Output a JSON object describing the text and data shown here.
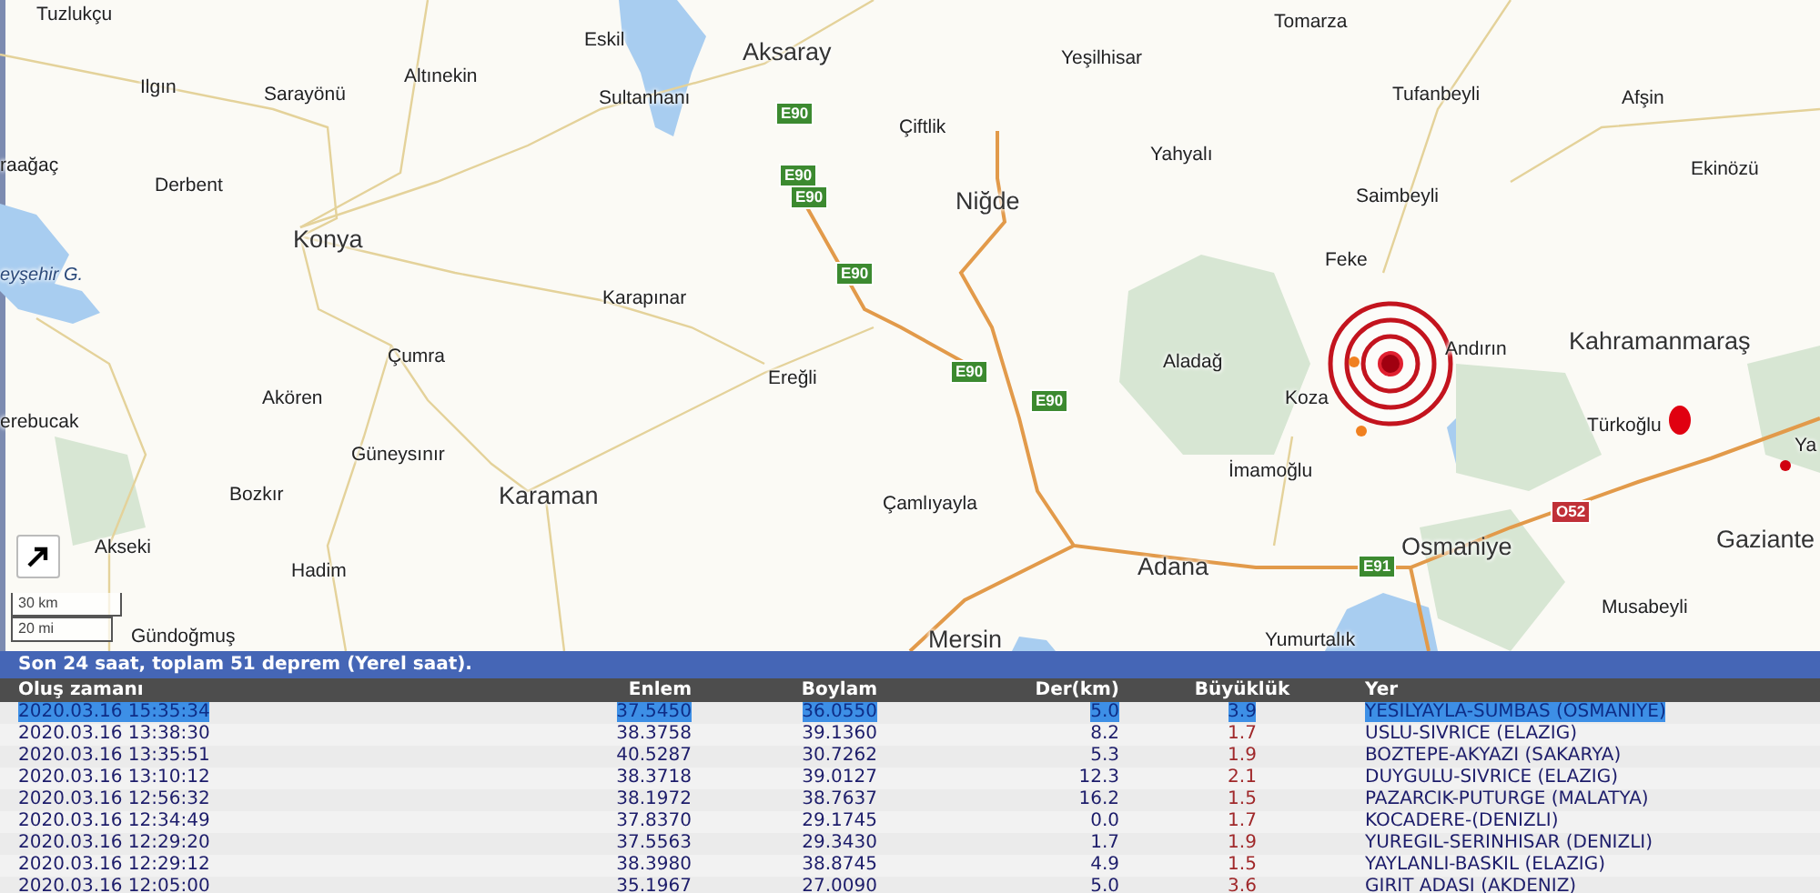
{
  "map": {
    "places": [
      {
        "name": "Tuzlukçu",
        "kind": "town"
      },
      {
        "name": "Ilgın",
        "kind": "town"
      },
      {
        "name": "Sarayönü",
        "kind": "town"
      },
      {
        "name": "Altınekin",
        "kind": "town"
      },
      {
        "name": "Eskil",
        "kind": "town"
      },
      {
        "name": "Sultanhanı",
        "kind": "town"
      },
      {
        "name": "Aksaray",
        "kind": "city"
      },
      {
        "name": "raağaç",
        "kind": "town"
      },
      {
        "name": "Derbent",
        "kind": "town"
      },
      {
        "name": "Konya",
        "kind": "city"
      },
      {
        "name": "eyşehir G.",
        "kind": "water"
      },
      {
        "name": "Karapınar",
        "kind": "town"
      },
      {
        "name": "Çiftlik",
        "kind": "town"
      },
      {
        "name": "Tomarza",
        "kind": "town"
      },
      {
        "name": "Yeşilhisar",
        "kind": "town"
      },
      {
        "name": "Yahyalı",
        "kind": "town"
      },
      {
        "name": "Tufanbeyli",
        "kind": "town"
      },
      {
        "name": "Afşin",
        "kind": "town"
      },
      {
        "name": "Niğde",
        "kind": "city"
      },
      {
        "name": "Ekinözü",
        "kind": "town"
      },
      {
        "name": "Saimbeyli",
        "kind": "town"
      },
      {
        "name": "Feke",
        "kind": "town"
      },
      {
        "name": "Çumra",
        "kind": "town"
      },
      {
        "name": "Akören",
        "kind": "town"
      },
      {
        "name": "erebucak",
        "kind": "town"
      },
      {
        "name": "Güneysınır",
        "kind": "town"
      },
      {
        "name": "Bozkır",
        "kind": "town"
      },
      {
        "name": "Karaman",
        "kind": "city"
      },
      {
        "name": "Akseki",
        "kind": "town"
      },
      {
        "name": "Hadim",
        "kind": "town"
      },
      {
        "name": "Gündoğmuş",
        "kind": "town"
      },
      {
        "name": "Ereğli",
        "kind": "town"
      },
      {
        "name": "Aladağ",
        "kind": "town"
      },
      {
        "name": "Andırın",
        "kind": "town"
      },
      {
        "name": "Kahramanmaraş",
        "kind": "city"
      },
      {
        "name": "Koza",
        "kind": "town"
      },
      {
        "name": "Türkoğlu",
        "kind": "town"
      },
      {
        "name": "Ya",
        "kind": "town"
      },
      {
        "name": "İmamoğlu",
        "kind": "town"
      },
      {
        "name": "Çamlıyayla",
        "kind": "town"
      },
      {
        "name": "Osmaniye",
        "kind": "city"
      },
      {
        "name": "Adana",
        "kind": "city"
      },
      {
        "name": "Gaziante",
        "kind": "city"
      },
      {
        "name": "Musabeyli",
        "kind": "town"
      },
      {
        "name": "Mersin",
        "kind": "city"
      },
      {
        "name": "Yumurtalık",
        "kind": "town"
      }
    ],
    "road_signs": [
      {
        "label": "E90",
        "kind": "european"
      },
      {
        "label": "E90",
        "kind": "european"
      },
      {
        "label": "E90",
        "kind": "european"
      },
      {
        "label": "E90",
        "kind": "european"
      },
      {
        "label": "E90",
        "kind": "european"
      },
      {
        "label": "E90",
        "kind": "european"
      },
      {
        "label": "E91",
        "kind": "european"
      },
      {
        "label": "O52",
        "kind": "motorway"
      }
    ],
    "scale": [
      "30 km",
      "20 mi"
    ]
  },
  "list": {
    "summary": "Son 24 saat, toplam 51 deprem (Yerel saat).",
    "columns": [
      "Oluş zamanı",
      "Enlem",
      "Boylam",
      "Der(km)",
      "Büyüklük",
      "Yer"
    ],
    "rows": [
      {
        "time": "2020.03.16 15:35:34",
        "lat": "37.5450",
        "lon": "36.0550",
        "depth": "5.0",
        "mag": "3.9",
        "place": "YESILYAYLA-SUMBAS (OSMANIYE)",
        "selected": true
      },
      {
        "time": "2020.03.16 13:38:30",
        "lat": "38.3758",
        "lon": "39.1360",
        "depth": "8.2",
        "mag": "1.7",
        "place": "USLU-SIVRICE (ELAZIG)",
        "selected": false
      },
      {
        "time": "2020.03.16 13:35:51",
        "lat": "40.5287",
        "lon": "30.7262",
        "depth": "5.3",
        "mag": "1.9",
        "place": "BOZTEPE-AKYAZI (SAKARYA)",
        "selected": false
      },
      {
        "time": "2020.03.16 13:10:12",
        "lat": "38.3718",
        "lon": "39.0127",
        "depth": "12.3",
        "mag": "2.1",
        "place": "DUYGULU-SIVRICE (ELAZIG)",
        "selected": false
      },
      {
        "time": "2020.03.16 12:56:32",
        "lat": "38.1972",
        "lon": "38.7637",
        "depth": "16.2",
        "mag": "1.5",
        "place": "PAZARCIK-PUTURGE (MALATYA)",
        "selected": false
      },
      {
        "time": "2020.03.16 12:34:49",
        "lat": "37.8370",
        "lon": "29.1745",
        "depth": "0.0",
        "mag": "1.7",
        "place": "KOCADERE-(DENIZLI)",
        "selected": false
      },
      {
        "time": "2020.03.16 12:29:20",
        "lat": "37.5563",
        "lon": "29.3430",
        "depth": "1.7",
        "mag": "1.9",
        "place": "YUREGIL-SERINHISAR (DENIZLI)",
        "selected": false
      },
      {
        "time": "2020.03.16 12:29:12",
        "lat": "38.3980",
        "lon": "38.8745",
        "depth": "4.9",
        "mag": "1.5",
        "place": "YAYLANLI-BASKIL (ELAZIG)",
        "selected": false
      },
      {
        "time": "2020.03.16 12:05:00",
        "lat": "35.1967",
        "lon": "27.0090",
        "depth": "5.0",
        "mag": "3.6",
        "place": "GIRIT ADASI (AKDENIZ)",
        "selected": false
      }
    ]
  }
}
